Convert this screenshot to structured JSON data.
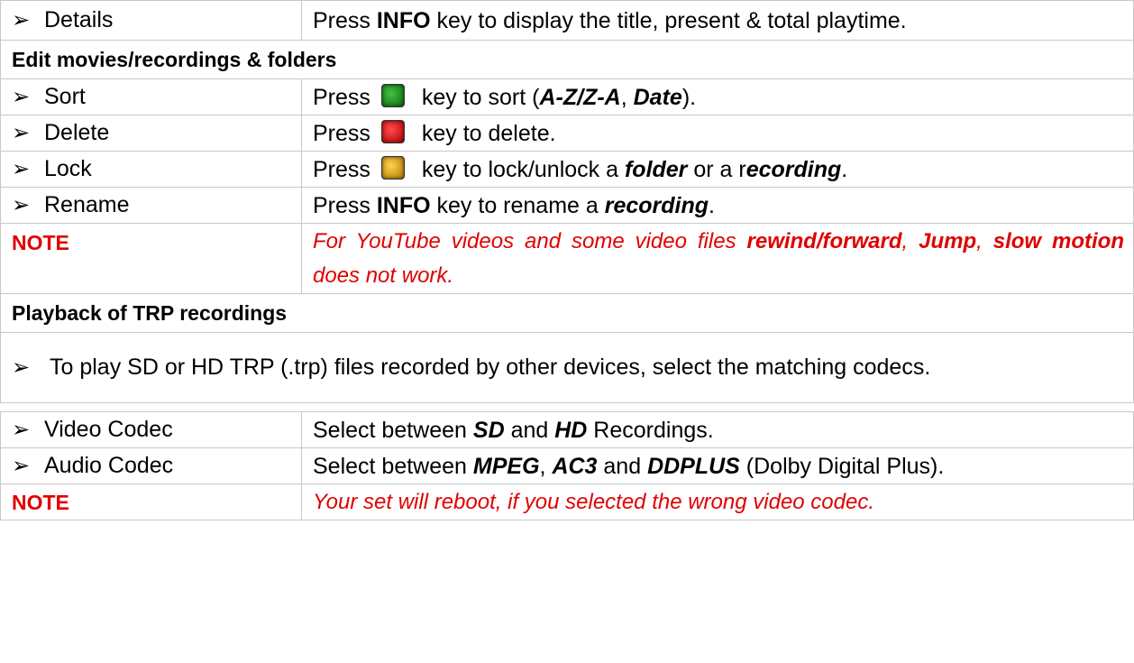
{
  "rows": {
    "details": {
      "label": "Details",
      "pre": "Press ",
      "key": "INFO",
      "post": " key to display the title, present & total playtime."
    },
    "edit_header": "Edit movies/recordings & folders",
    "sort": {
      "label": "Sort",
      "pre": "Press",
      "post1": " key to sort (",
      "b1": "A-Z",
      "sep": "/",
      "b2": "Z-A",
      "comma": ", ",
      "b3": "Date",
      "end": ").",
      "key_icon": "green-key-icon"
    },
    "delete": {
      "label": "Delete",
      "pre": "Press",
      "post": " key to delete.",
      "key_icon": "red-key-icon"
    },
    "lock": {
      "label": "Lock",
      "pre": "Press",
      "post1": " key to lock/unlock a ",
      "b1": "folder",
      "mid": " or a r",
      "b2": "ecording",
      "end": ".",
      "key_icon": "yellow-key-icon"
    },
    "rename": {
      "label": "Rename",
      "pre": "Press ",
      "key": "INFO",
      "post1": " key to rename a ",
      "b1": "recording",
      "end": "."
    },
    "note1": {
      "label": "NOTE",
      "t1": "For YouTube videos and some video files ",
      "b1": "rewind/forward",
      "t2": ", ",
      "b2": "Jump",
      "t3": ", ",
      "b3": "slow motion",
      "t4": " does not work."
    },
    "trp_header": "Playback of TRP recordings",
    "trp_info": "To play SD or HD TRP (.trp) files recorded by other devices, select the matching codecs.",
    "video_codec": {
      "label": "Video Codec",
      "pre": "Select between ",
      "b1": "SD",
      "mid": " and ",
      "b2": "HD",
      "end": " Recordings."
    },
    "audio_codec": {
      "label": "Audio Codec",
      "pre": "Select between ",
      "b1": "MPEG",
      "c1": ", ",
      "b2": "AC3",
      "mid": " and ",
      "b3": "DDPLUS",
      "end": " (Dolby Digital Plus)."
    },
    "note2": {
      "label": "NOTE",
      "text": "Your set will reboot, if you selected the wrong video codec."
    }
  },
  "colors": {
    "note": "#e00000",
    "border": "#c8c8c8"
  }
}
